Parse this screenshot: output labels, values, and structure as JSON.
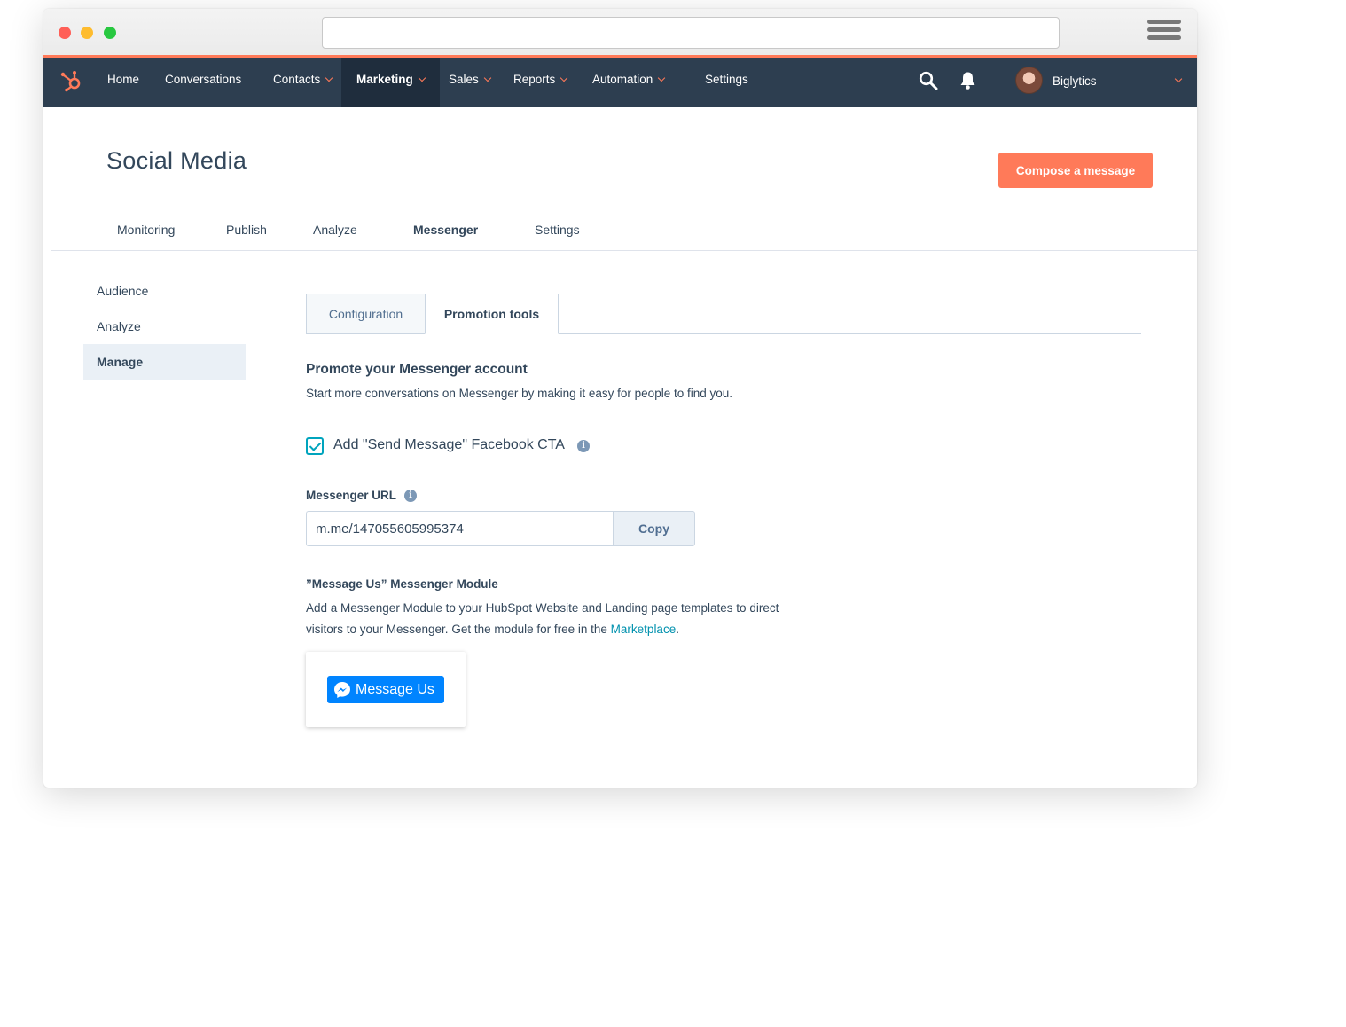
{
  "nav": {
    "items": [
      {
        "label": "Home",
        "dropdown": false
      },
      {
        "label": "Conversations",
        "dropdown": false
      },
      {
        "label": "Contacts",
        "dropdown": true
      },
      {
        "label": "Marketing",
        "dropdown": true,
        "active": true
      },
      {
        "label": "Sales",
        "dropdown": true
      },
      {
        "label": "Reports",
        "dropdown": true
      },
      {
        "label": "Automation",
        "dropdown": true
      },
      {
        "label": "Settings",
        "dropdown": false
      }
    ],
    "account_name": "Biglytics",
    "icons": [
      "hubspot-logo-icon",
      "search-icon",
      "bell-icon",
      "chevron-down-icon"
    ]
  },
  "page": {
    "title": "Social Media",
    "compose_label": "Compose a message"
  },
  "main_tabs": [
    {
      "label": "Monitoring"
    },
    {
      "label": "Publish"
    },
    {
      "label": "Analyze"
    },
    {
      "label": "Messenger",
      "active": true
    },
    {
      "label": "Settings"
    }
  ],
  "sidebar": {
    "items": [
      {
        "label": "Audience"
      },
      {
        "label": "Analyze"
      },
      {
        "label": "Manage",
        "active": true
      }
    ]
  },
  "subtabs": [
    {
      "label": "Configuration"
    },
    {
      "label": "Promotion tools",
      "active": true
    }
  ],
  "promotion": {
    "heading": "Promote your Messenger account",
    "description": "Start more conversations on Messenger by making it easy for people to find you.",
    "cta_checkbox_label": "Add \"Send Message\" Facebook CTA",
    "cta_checked": true,
    "url_label": "Messenger URL",
    "url_value": "m.me/147055605995374",
    "copy_label": "Copy",
    "module_title": "”Message Us” Messenger Module",
    "module_desc_1": "Add a Messenger Module to your HubSpot Website and Landing page templates to direct visitors to your Messenger. Get the module for free in the ",
    "module_link": "Marketplace",
    "module_desc_2": ".",
    "preview_button_label": "Message Us"
  },
  "colors": {
    "navbar": "#2d3e50",
    "accent": "#ff7a59",
    "checkbox": "#00a4bd",
    "link": "#0091ae",
    "messenger_blue": "#0084ff"
  }
}
